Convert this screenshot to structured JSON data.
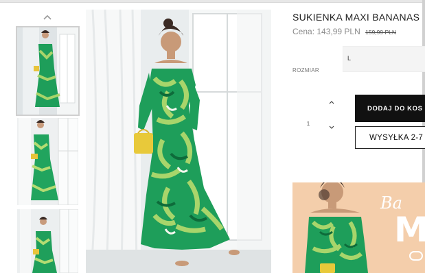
{
  "product": {
    "title": "SUKIENKA MAXI BANANAS",
    "price_label": "Cena:",
    "price": "143,99 PLN",
    "old_price": "159,99 PLN"
  },
  "options": {
    "size_label": "ROZMIAR",
    "size_value": "L"
  },
  "quantity": {
    "value": "1"
  },
  "actions": {
    "add_to_cart": "DODAJ DO KOS",
    "shipping": "WYSYŁKA 2-7"
  },
  "banner": {
    "script_text": "Ba",
    "big_text": "M"
  },
  "icons": {
    "thumbs_prev": "chevron-up-icon",
    "qty_up": "chevron-up-icon",
    "qty_down": "chevron-down-icon"
  },
  "colors": {
    "button_dark": "#111111",
    "banner_bg": "#f4ceab",
    "dress_green": "#1e9e5a"
  }
}
